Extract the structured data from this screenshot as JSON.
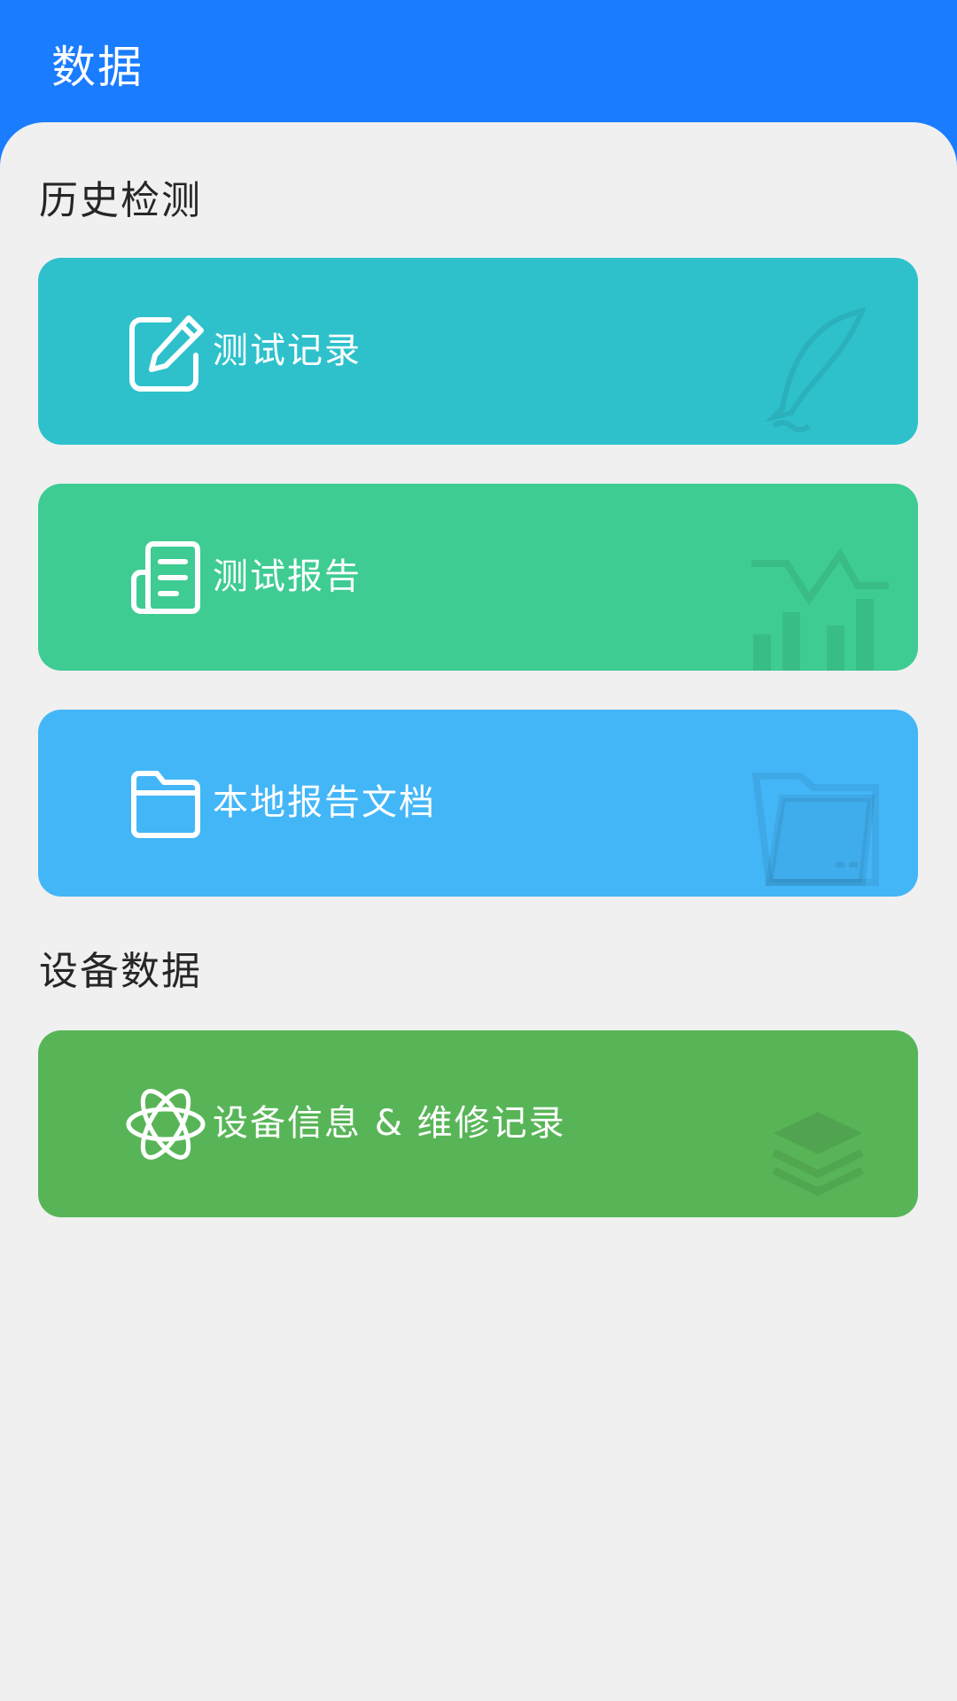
{
  "header": {
    "title": "数据"
  },
  "sections": [
    {
      "title": "历史检测",
      "cards": [
        {
          "label": "测试记录",
          "icon": "edit-icon",
          "deco": "quill-icon",
          "color": "#2ec1cc"
        },
        {
          "label": "测试报告",
          "icon": "report-icon",
          "deco": "chart-icon",
          "color": "#3ecc92"
        },
        {
          "label": "本地报告文档",
          "icon": "folder-icon",
          "deco": "folders-icon",
          "color": "#43b6f8"
        }
      ]
    },
    {
      "title": "设备数据",
      "cards": [
        {
          "label": "设备信息 & 维修记录",
          "icon": "atom-icon",
          "deco": "layers-icon",
          "color": "#58b557"
        }
      ]
    }
  ]
}
